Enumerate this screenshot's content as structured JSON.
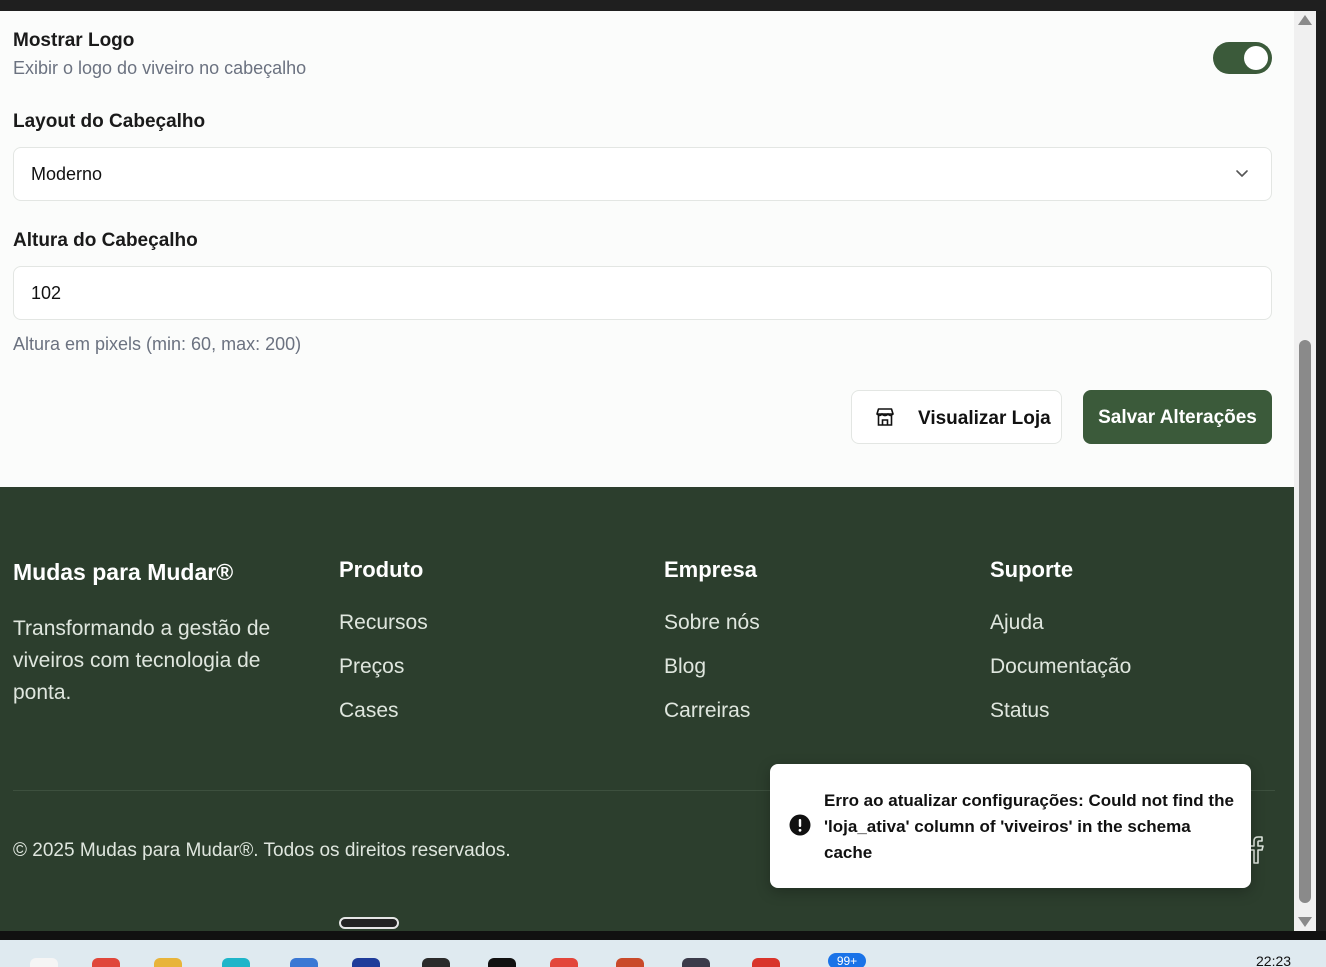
{
  "settings": {
    "show_logo": {
      "title": "Mostrar Logo",
      "description": "Exibir o logo do viveiro no cabeçalho",
      "enabled": true
    },
    "header_layout": {
      "label": "Layout do Cabeçalho",
      "value": "Moderno"
    },
    "header_height": {
      "label": "Altura do Cabeçalho",
      "value": "102",
      "hint": "Altura em pixels (min: 60, max: 200)"
    },
    "buttons": {
      "preview_store": "Visualizar Loja",
      "save_changes": "Salvar Alterações"
    }
  },
  "footer": {
    "brand": "Mudas para Mudar®",
    "tagline": "Transformando a gestão de viveiros com tecnologia de ponta.",
    "columns": [
      {
        "title": "Produto",
        "links": [
          "Recursos",
          "Preços",
          "Cases"
        ]
      },
      {
        "title": "Empresa",
        "links": [
          "Sobre nós",
          "Blog",
          "Carreiras"
        ]
      },
      {
        "title": "Suporte",
        "links": [
          "Ajuda",
          "Documentação",
          "Status"
        ]
      }
    ],
    "copyright": "© 2025 Mudas para Mudar®. Todos os direitos reservados.",
    "social_icon": "facebook-icon"
  },
  "toast": {
    "message": "Erro ao atualizar configurações: Could not find the 'loja_ativa' column of 'viveiros' in the schema cache",
    "icon": "error-icon"
  },
  "taskbar": {
    "badge": "99+",
    "time": "22:23"
  },
  "colors": {
    "primary": "#3b5a3a",
    "footer_bg": "#2c3e2d",
    "muted_text": "#6b7280"
  }
}
